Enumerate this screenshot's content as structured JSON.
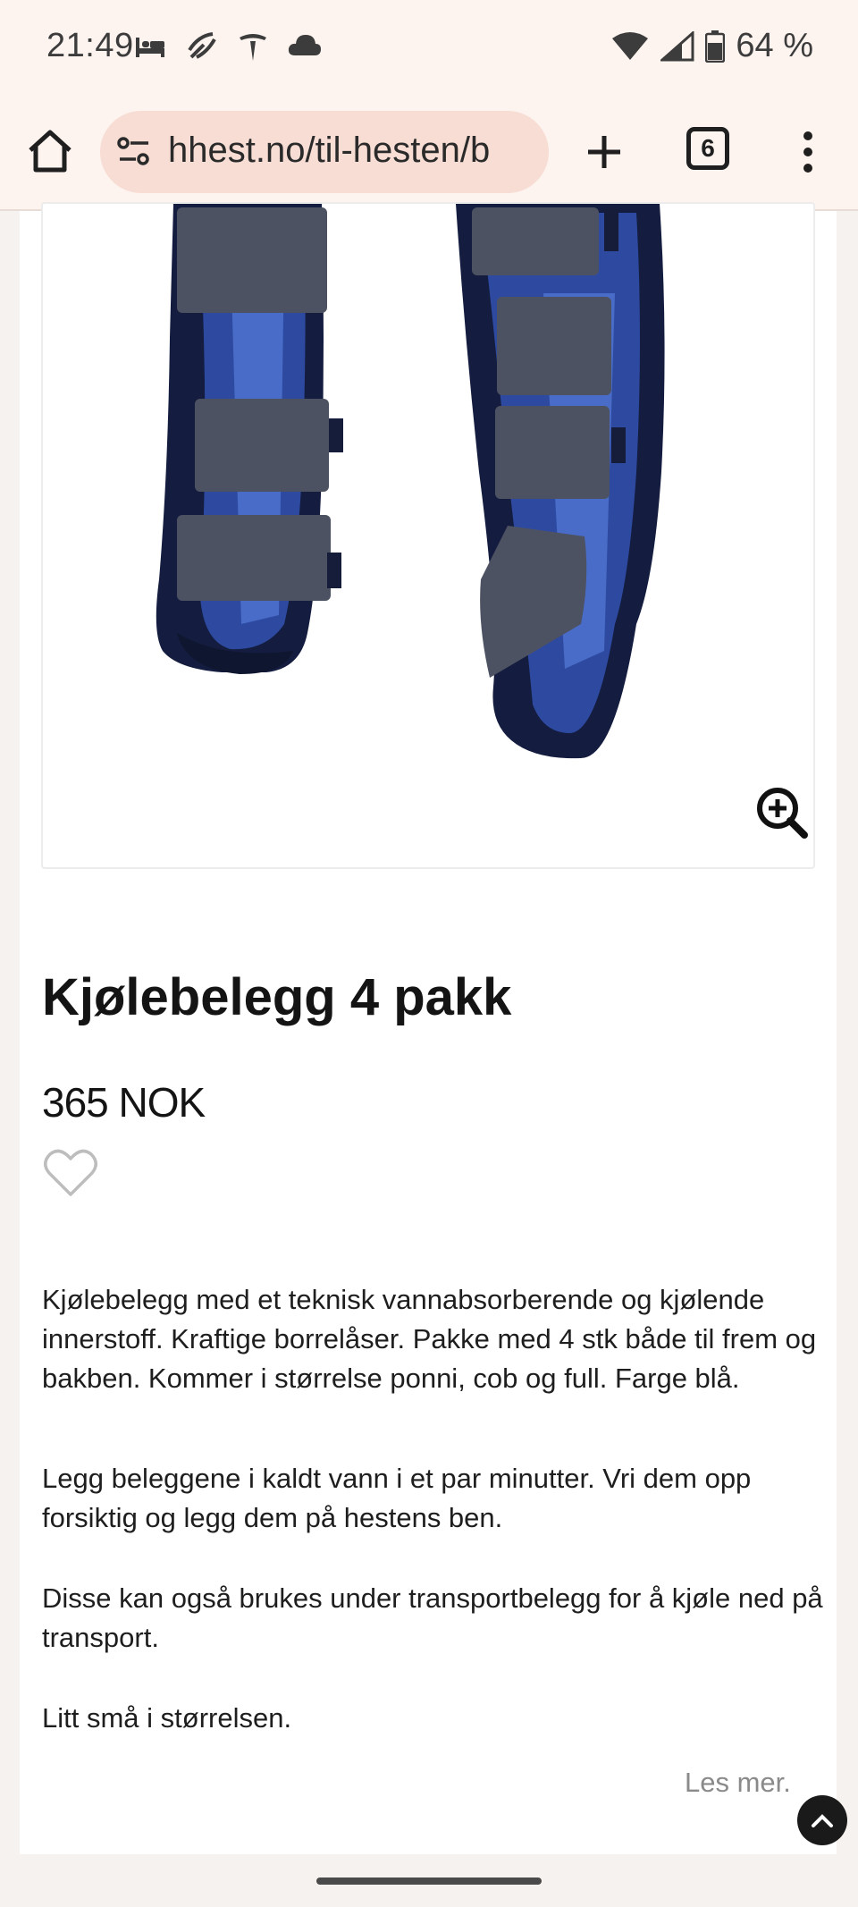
{
  "status_bar": {
    "time": "21:49",
    "left_icons": [
      "bed-icon",
      "satellite-icon",
      "tesla-icon",
      "cloud-icon"
    ],
    "right_icons": [
      "wifi-icon",
      "signal-icon",
      "battery-icon"
    ],
    "battery": "64 %"
  },
  "browser": {
    "url": "hhest.no/til-hesten/b",
    "tab_count": "6"
  },
  "product": {
    "title": "Kjølebelegg 4 pakk",
    "price": "365 NOK",
    "description": [
      "Kjølebelegg med et teknisk vannabsorberende og kjølende innerstoff. Kraftige borrelåser. Pakke med 4 stk både til frem og bakben. Kommer i størrelse ponni, cob og full. Farge blå.",
      "Legg beleggene i kaldt vann i et par minutter. Vri dem opp forsiktig og legg dem på hestens ben.",
      "Disse kan også brukes under transportbelegg for å kjøle ned på transport.",
      "Litt små i størrelsen."
    ],
    "read_more": "Les mer."
  },
  "colors": {
    "status_bg": "#fdf3ef",
    "url_pill": "#f7ddd4",
    "boot_navy": "#1b2550",
    "boot_mesh": "#3a5bb8",
    "strap_gray": "#4d5263"
  }
}
